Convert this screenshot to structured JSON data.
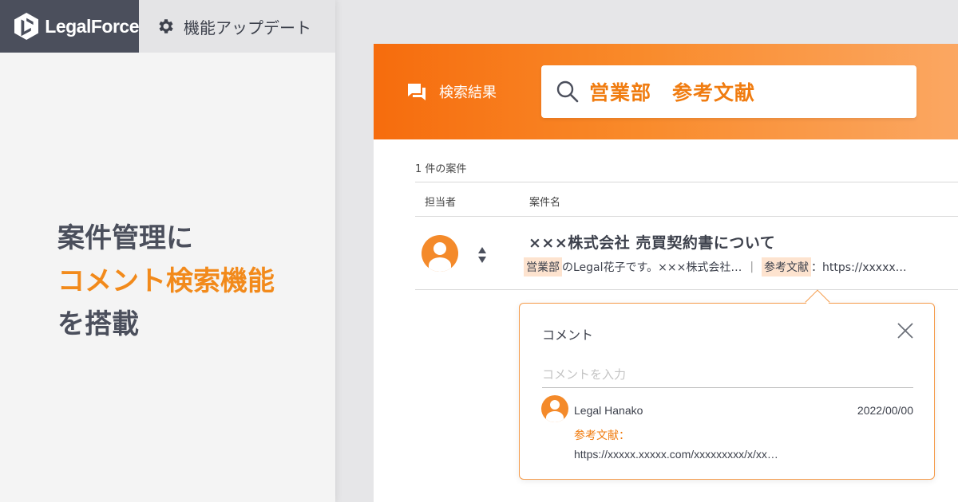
{
  "brand": {
    "name": "LegalForce"
  },
  "nav": {
    "update_tab": "機能アップデート"
  },
  "headline": {
    "line1": "案件管理に",
    "line2": "コメント検索機能",
    "line3": "を搭載"
  },
  "search": {
    "section_label": "検索結果",
    "query": "営業部　参考文献"
  },
  "results": {
    "count": "1 件の案件",
    "columns": {
      "assignee": "担当者",
      "matter": "案件名"
    },
    "rows": [
      {
        "title": "×××株式会社 売買契約書について",
        "snippet_hl1": "営業部",
        "snippet_text": "のLegal花子です。×××株式会社…",
        "snippet_sep": "|",
        "snippet_hl2": "参考文献",
        "snippet_rest": "：https://xxxxx…"
      }
    ]
  },
  "comment_popover": {
    "title": "コメント",
    "placeholder": "コメントを入力",
    "comments": [
      {
        "author": "Legal Hanako",
        "date": "2022/00/00",
        "label": "参考文献：",
        "url": "https://xxxxx.xxxxx.com/xxxxxxxxx/x/xx…"
      }
    ]
  },
  "colors": {
    "accent": "#f28a1b",
    "dark": "#4b4f5c",
    "banner_start": "#f66c0d",
    "banner_end": "#fba762"
  },
  "icons": [
    "legalforce-logo-icon",
    "gear-icon",
    "chat-icon",
    "search-icon",
    "user-avatar-icon",
    "sort-icon",
    "close-icon"
  ]
}
